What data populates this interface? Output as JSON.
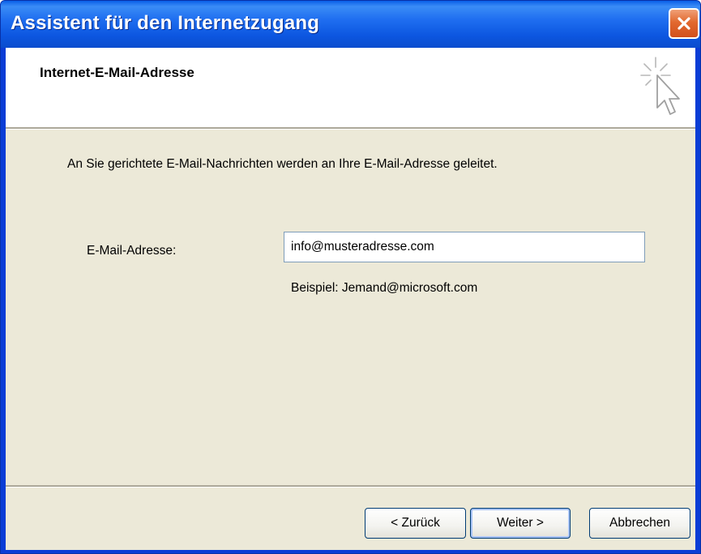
{
  "window": {
    "title": "Assistent für den Internetzugang"
  },
  "header": {
    "title": "Internet-E-Mail-Adresse"
  },
  "main": {
    "intro_text": "An Sie gerichtete E-Mail-Nachrichten werden an Ihre E-Mail-Adresse geleitet.",
    "email_label": "E-Mail-Adresse:",
    "email_value": "info@musteradresse.com",
    "example_text": "Beispiel: Jemand@microsoft.com"
  },
  "buttons": {
    "back_label": "< Zurück",
    "next_label": "Weiter >",
    "cancel_label": "Abbrechen"
  },
  "icons": {
    "close": "close-icon",
    "wizard": "wizard-cursor-icon"
  },
  "colors": {
    "titlebar": "#0c56e0",
    "close_button": "#e2692f",
    "dialog_background": "#ece9d8",
    "header_background": "#ffffff"
  }
}
